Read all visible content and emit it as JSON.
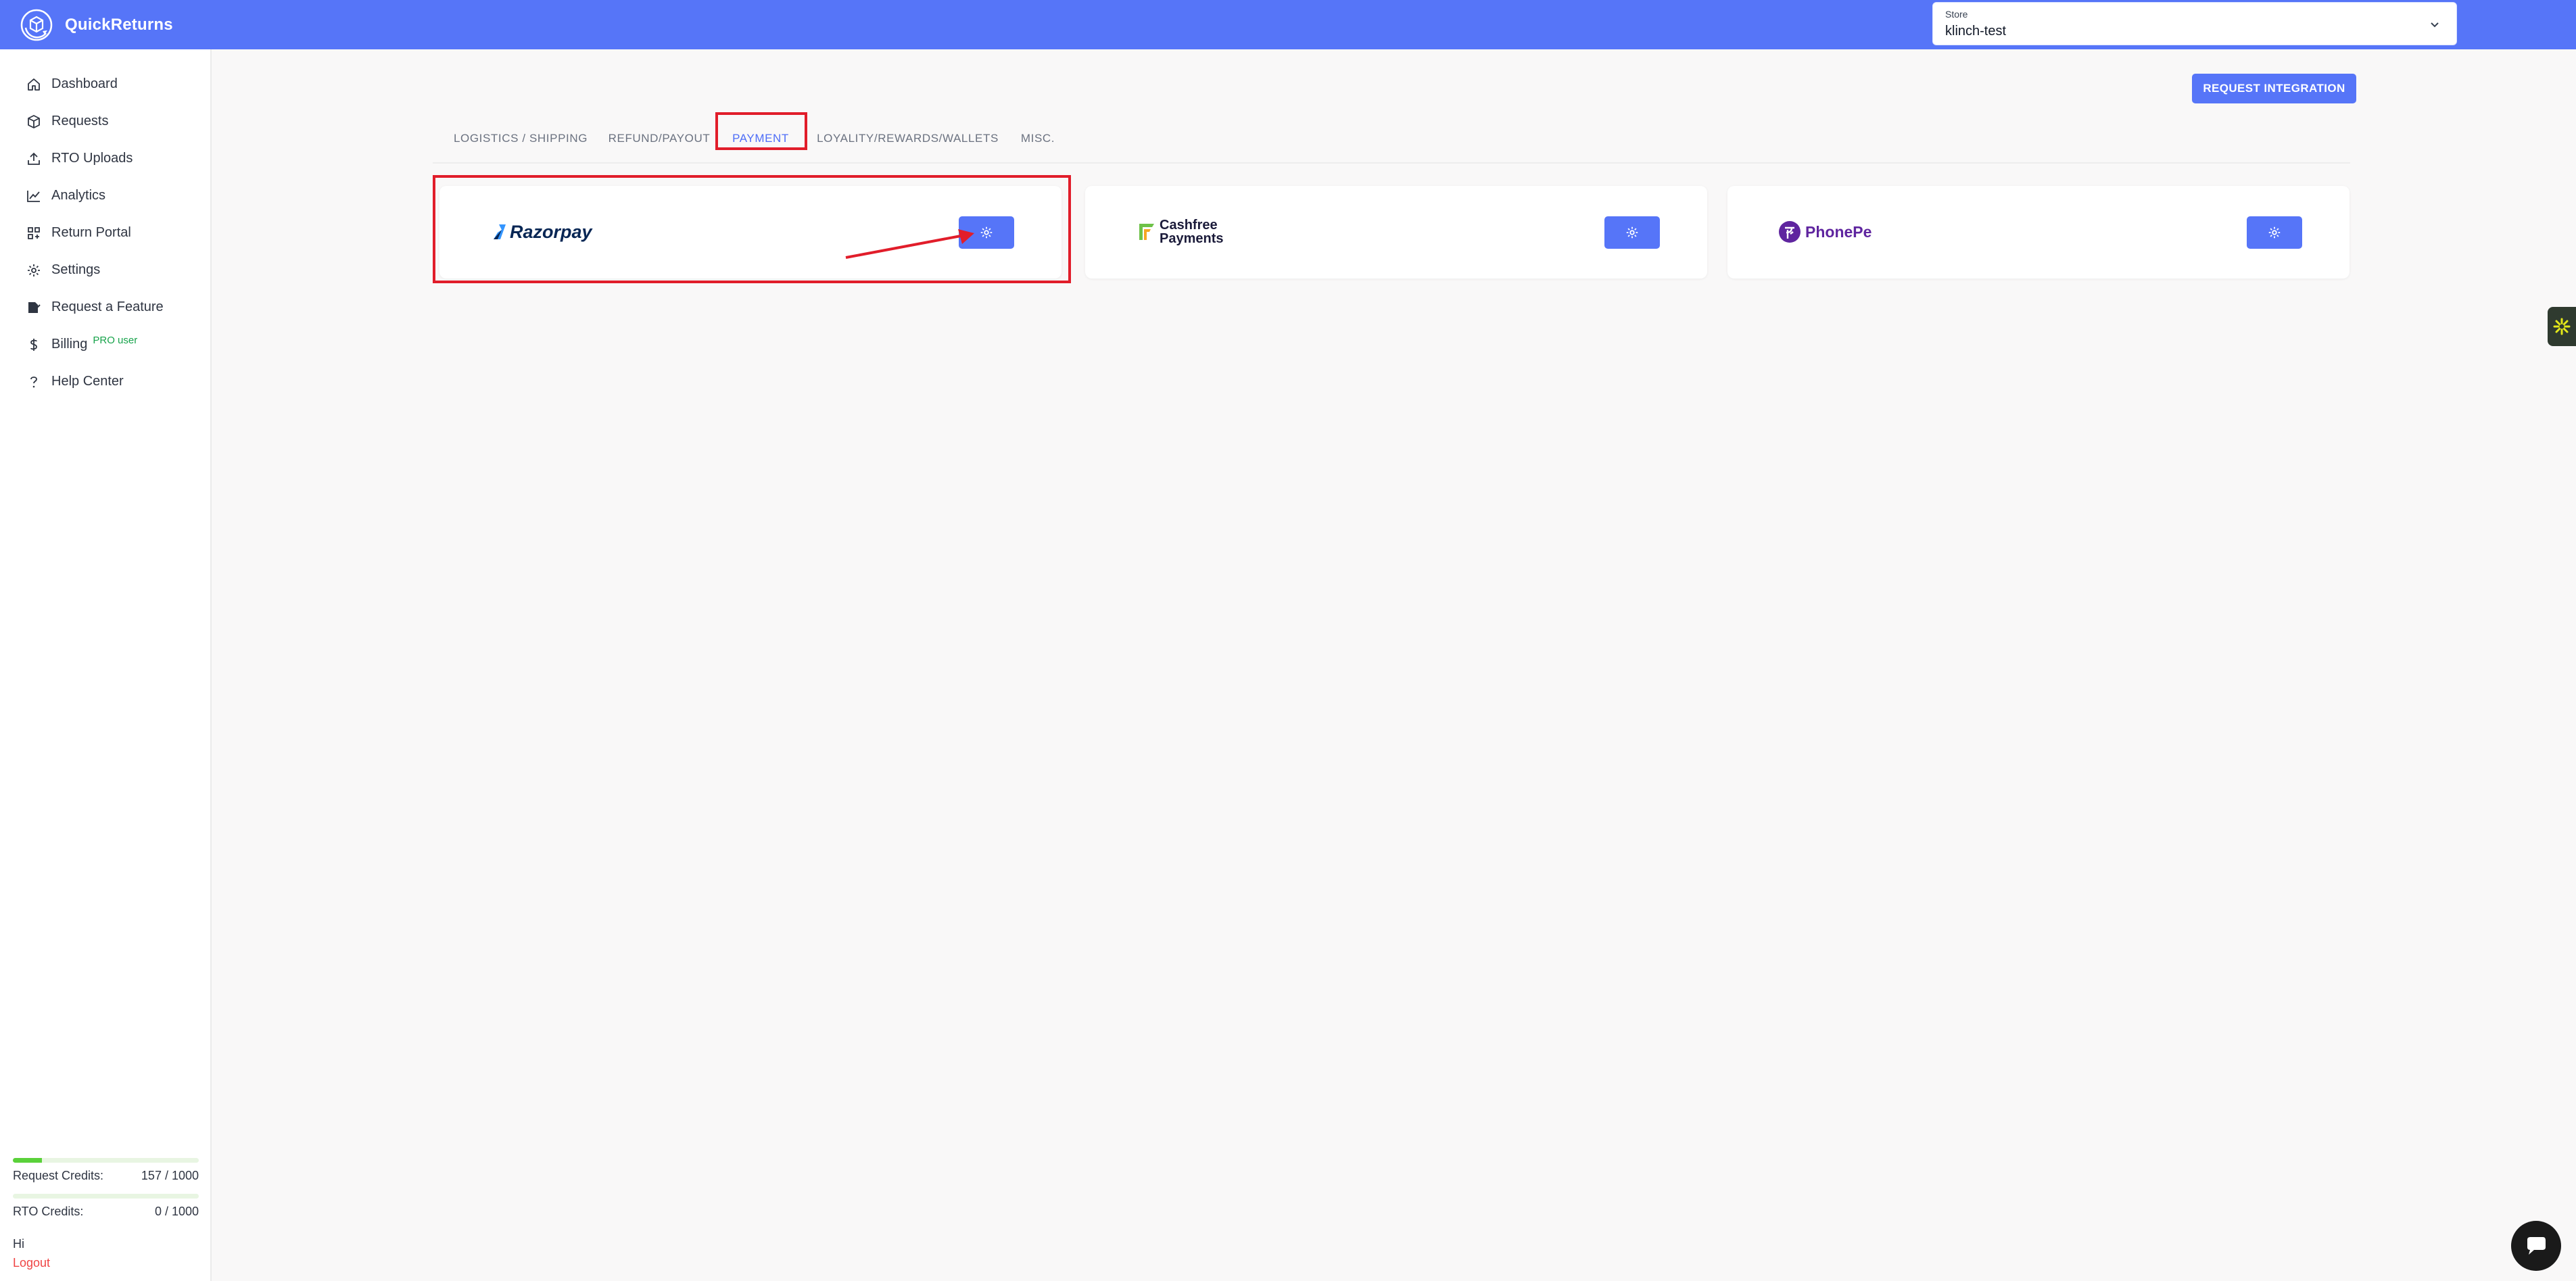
{
  "app": {
    "name": "QuickReturns"
  },
  "store": {
    "label": "Store",
    "value": "klinch-test"
  },
  "sidebar": {
    "items": [
      {
        "label": "Dashboard"
      },
      {
        "label": "Requests"
      },
      {
        "label": "RTO Uploads"
      },
      {
        "label": "Analytics"
      },
      {
        "label": "Return Portal"
      },
      {
        "label": "Settings"
      },
      {
        "label": "Request a Feature"
      },
      {
        "label": "Billing",
        "badge": "PRO user"
      },
      {
        "label": "Help Center"
      }
    ],
    "credits": {
      "request_label": "Request Credits:",
      "request_value": "157 / 1000",
      "request_fraction": 0.157,
      "rto_label": "RTO Credits:",
      "rto_value": "0 / 1000",
      "rto_fraction": 0
    },
    "greeting": "Hi",
    "logout_label": "Logout"
  },
  "main": {
    "request_button": "REQUEST INTEGRATION",
    "tabs": [
      {
        "label": "LOGISTICS / SHIPPING"
      },
      {
        "label": "REFUND/PAYOUT"
      },
      {
        "label": "PAYMENT",
        "active": true
      },
      {
        "label": "LOYALITY/REWARDS/WALLETS"
      },
      {
        "label": "MISC."
      }
    ],
    "integrations": [
      {
        "name": "Razorpay"
      },
      {
        "name_line1": "Cashfree",
        "name_line2": "Payments"
      },
      {
        "name": "PhonePe"
      }
    ]
  },
  "colors": {
    "primary": "#5675f8",
    "highlight": "#e11d2a",
    "pro": "#16a34a",
    "logout": "#ef4444",
    "razorpay": "#072654",
    "phonepe": "#5f259f"
  }
}
